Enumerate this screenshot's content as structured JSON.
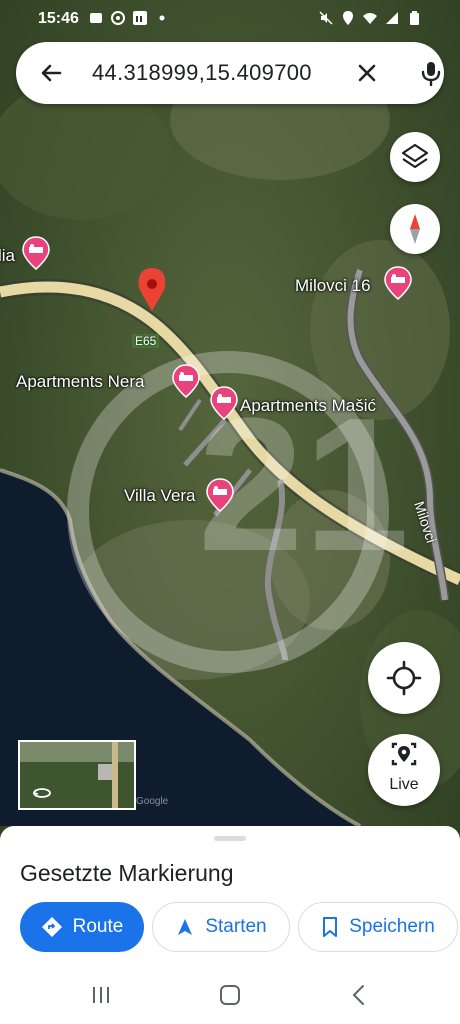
{
  "status_bar": {
    "time": "15:46",
    "left_icons": [
      "notification-icon",
      "app-icon",
      "linkedin-icon",
      "dot-icon"
    ],
    "right_icons": [
      "mute-icon",
      "location-icon",
      "wifi-icon",
      "signal-icon",
      "battery-icon"
    ]
  },
  "search": {
    "query": "44.318999,15.409700"
  },
  "map": {
    "labels": {
      "partial_left": "lia",
      "milovci16": "Milovci 16",
      "apartments_nera": "Apartments Nera",
      "apartments_masic": "Apartments Mašić",
      "villa_vera": "Villa Vera",
      "road_e65": "E65",
      "road_milovci": "Milovci"
    },
    "watermark_text": "21",
    "attribution": "Google"
  },
  "controls": {
    "live_label": "Live"
  },
  "sheet": {
    "title": "Gesetzte Markierung",
    "route_label": "Route",
    "start_label": "Starten",
    "save_label": "Speichern"
  },
  "colors": {
    "accent": "#1a73e8",
    "pin_red": "#ea4335",
    "hotel_pin": "#e8437b",
    "road": "#e7d9a4"
  }
}
